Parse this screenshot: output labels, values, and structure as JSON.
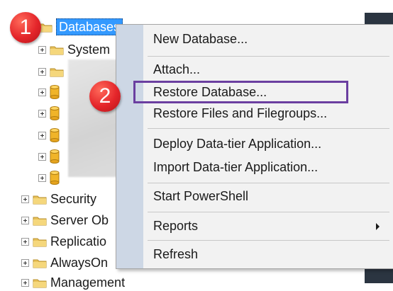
{
  "tree": {
    "root_label": "Databases",
    "items": [
      {
        "label": "System",
        "icon": "folder-icon"
      },
      {
        "label": "",
        "icon": "folder-icon"
      },
      {
        "label": "",
        "icon": "database-icon"
      },
      {
        "label": "",
        "icon": "database-icon"
      },
      {
        "label": "",
        "icon": "database-icon"
      },
      {
        "label": "",
        "icon": "database-icon"
      },
      {
        "label": "",
        "icon": "database-icon"
      }
    ],
    "siblings": [
      {
        "label": "Security"
      },
      {
        "label": "Server Ob"
      },
      {
        "label": "Replicatio"
      },
      {
        "label": "AlwaysOn"
      },
      {
        "label": "Management"
      }
    ]
  },
  "context_menu": {
    "new_database": "New Database...",
    "attach": "Attach...",
    "restore_database": "Restore Database...",
    "restore_files": "Restore Files and Filegroups...",
    "deploy_data_tier": "Deploy Data-tier Application...",
    "import_data_tier": "Import Data-tier Application...",
    "start_powershell": "Start PowerShell",
    "reports": "Reports",
    "refresh": "Refresh"
  },
  "callouts": {
    "step1": "1",
    "step2": "2"
  },
  "colors": {
    "selection": "#3399ff",
    "highlight_outline": "#6b3fa0",
    "badge": "#e4252a"
  }
}
